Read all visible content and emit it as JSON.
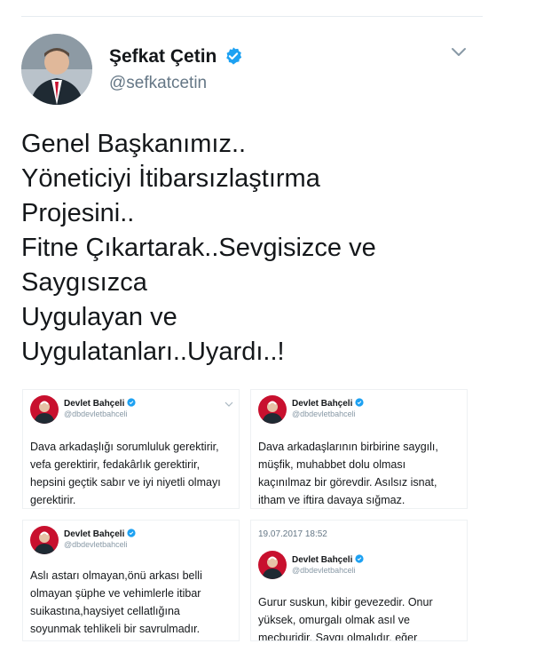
{
  "tweet": {
    "author_name": "Şefkat Çetin",
    "author_handle": "@sefkatcetin",
    "text_lines": [
      "Genel Başkanımız..",
      "Yöneticiyi İtibarsızlaştırma",
      "Projesini..",
      "Fitne Çıkartarak..Sevgisizce ve",
      "Saygısızca",
      "Uygulayan ve",
      "Uygulatanları..Uyardı..!"
    ]
  },
  "embedded": [
    {
      "name": "Devlet Bahçeli",
      "handle": "@dbdevletbahceli",
      "lines": [
        "Dava arkadaşlığı sorumluluk gerektirir,",
        "vefa gerektirir, fedakârlık gerektirir,",
        "hepsini geçtik sabır ve iyi niyetli olmayı",
        "gerektirir."
      ]
    },
    {
      "name": "Devlet Bahçeli",
      "handle": "@dbdevletbahceli",
      "lines": [
        "Dava arkadaşlarının birbirine saygılı,",
        "müşfik, muhabbet dolu olması",
        "kaçınılmaz bir görevdir. Asılsız isnat,",
        "itham ve iftira davaya sığmaz."
      ]
    },
    {
      "name": "Devlet Bahçeli",
      "handle": "@dbdevletbahceli",
      "lines": [
        "Aslı astarı olmayan,önü arkası belli",
        "olmayan şüphe ve vehimlerle itibar",
        "suikastına,haysiyet cellatlığına",
        "soyunmak tehlikeli bir savrulmadır."
      ]
    },
    {
      "date": "19.07.2017 18:52",
      "name": "Devlet Bahçeli",
      "handle": "@dbdevletbahceli",
      "lines": [
        "Gurur suskun, kibir gevezedir. Onur",
        "yüksek, omurgalı olmak asıl ve",
        "mecburidir. Saygı olmalıdır, eğer"
      ]
    }
  ],
  "colors": {
    "verified_blue": "#1da1f2",
    "handle_gray": "#657786",
    "brand_red": "#c8102e"
  },
  "icons": [
    "verified-badge-icon",
    "chevron-down-icon"
  ]
}
